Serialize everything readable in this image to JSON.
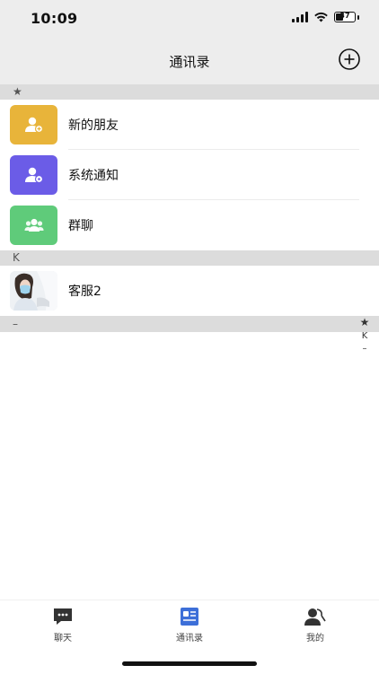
{
  "status_bar": {
    "time": "10:09",
    "battery_level": "37"
  },
  "header": {
    "title": "通讯录"
  },
  "sections": [
    {
      "index": "★",
      "items": [
        {
          "label": "新的朋友",
          "color": "#E8B43A",
          "icon": "add-friend-icon"
        },
        {
          "label": "系统通知",
          "color": "#6B5CE7",
          "icon": "notification-user-icon"
        },
        {
          "label": "群聊",
          "color": "#5FCB7A",
          "icon": "group-icon"
        }
      ]
    },
    {
      "index": "K",
      "items": [
        {
          "label": "客服2",
          "icon": "avatar-photo"
        }
      ]
    },
    {
      "index": "–",
      "items": []
    }
  ],
  "index_bar": [
    "★",
    "K",
    "–"
  ],
  "tabbar": {
    "tabs": [
      {
        "label": "聊天",
        "icon": "chat-icon"
      },
      {
        "label": "通讯录",
        "icon": "contacts-icon",
        "active": true
      },
      {
        "label": "我的",
        "icon": "profile-icon"
      }
    ]
  }
}
